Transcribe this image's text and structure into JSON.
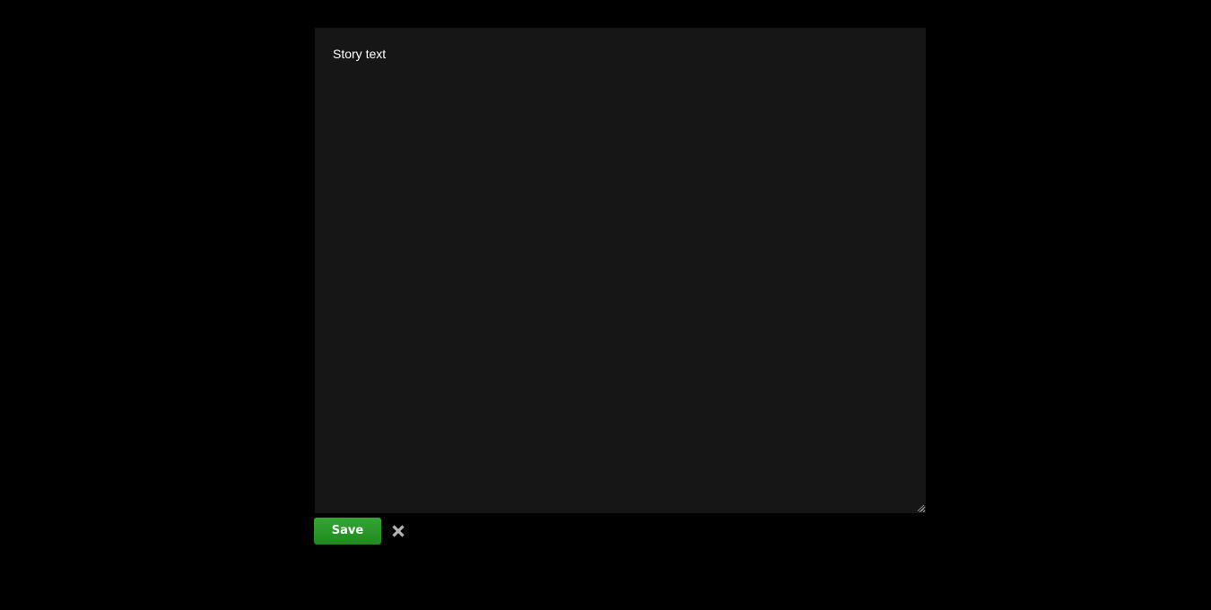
{
  "editor": {
    "placeholder": "Story text",
    "value": ""
  },
  "actions": {
    "save_label": "Save",
    "close_icon": "close-icon"
  },
  "colors": {
    "background": "#000000",
    "editor_background": "#161616",
    "editor_text": "#ffffff",
    "save_button": "#239423",
    "close_icon": "#b4b4b4"
  }
}
